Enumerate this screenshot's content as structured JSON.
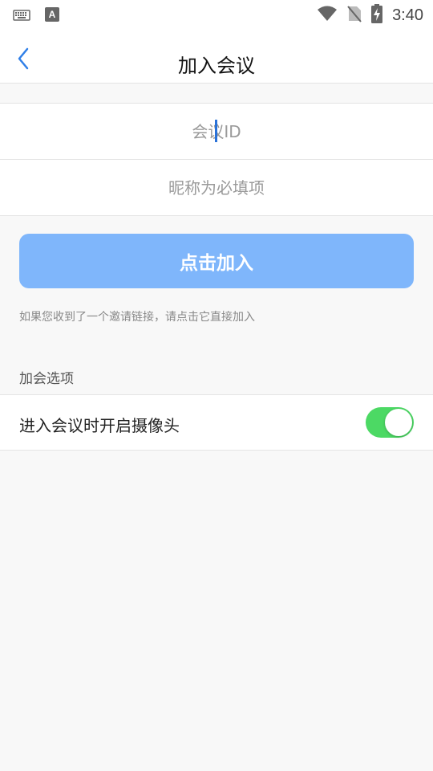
{
  "status_bar": {
    "time": "3:40",
    "icons": [
      "keyboard-icon",
      "font-a-icon",
      "wifi-icon",
      "no-sim-icon",
      "battery-charging-icon"
    ]
  },
  "header": {
    "title": "加入会议",
    "back_icon": "chevron-left-icon"
  },
  "form": {
    "meeting_id": {
      "value": "",
      "placeholder": "会议ID"
    },
    "nickname": {
      "value": "",
      "placeholder": "昵称为必填项"
    }
  },
  "join_button": {
    "label": "点击加入",
    "color": "#7fb6fb"
  },
  "hint": "如果您收到了一个邀请链接，请点击它直接加入",
  "options": {
    "section_title": "加会选项",
    "items": [
      {
        "label": "进入会议时开启摄像头",
        "enabled": true
      }
    ]
  },
  "colors": {
    "accent": "#2f7fe8",
    "toggle_on": "#4cd964",
    "background": "#f8f8f8"
  }
}
